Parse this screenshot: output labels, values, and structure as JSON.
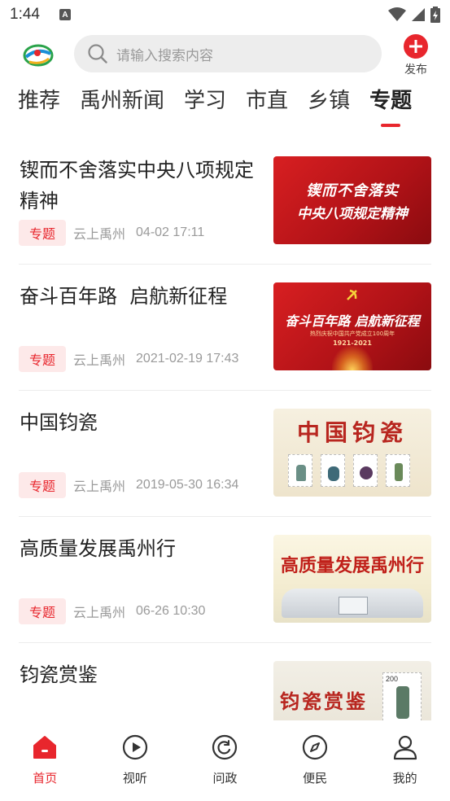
{
  "status_bar": {
    "time": "1:44",
    "notification_icon": "A"
  },
  "header": {
    "logo_icon": "yunshang-yuzhou-logo",
    "search_placeholder": "请输入搜索内容",
    "publish_label": "发布"
  },
  "tabs": [
    {
      "label": "推荐",
      "active": false
    },
    {
      "label": "禹州新闻",
      "active": false
    },
    {
      "label": "学习",
      "active": false
    },
    {
      "label": "市直",
      "active": false
    },
    {
      "label": "乡镇",
      "active": false
    },
    {
      "label": "专题",
      "active": true
    }
  ],
  "articles": [
    {
      "title": "锲而不舍落实中央八项规定精神",
      "tag": "专题",
      "source": "云上禹州",
      "time": "04-02 17:11",
      "thumb_text": [
        "锲而不舍落实",
        "中央八项规定精神"
      ]
    },
    {
      "title": "奋斗百年路  启航新征程",
      "tag": "专题",
      "source": "云上禹州",
      "time": "2021-02-19 17:43",
      "thumb_text": [
        "奋斗百年路 启航新征程",
        "热烈庆祝中国共产党成立100周年",
        "1921-2021"
      ]
    },
    {
      "title": "中国钧瓷",
      "tag": "专题",
      "source": "云上禹州",
      "time": "2019-05-30 16:34",
      "thumb_text": [
        "中国钧瓷"
      ]
    },
    {
      "title": "高质量发展禹州行",
      "tag": "专题",
      "source": "云上禹州",
      "time": "06-26 10:30",
      "thumb_text": [
        "高质量发展禹州行"
      ]
    },
    {
      "title": "钧瓷赏鉴",
      "thumb_text": [
        "钧瓷赏鉴",
        "200"
      ]
    }
  ],
  "bottom_nav": [
    {
      "label": "首页",
      "icon": "home-icon",
      "active": true
    },
    {
      "label": "视听",
      "icon": "play-icon",
      "active": false
    },
    {
      "label": "问政",
      "icon": "refresh-icon",
      "active": false
    },
    {
      "label": "便民",
      "icon": "compass-icon",
      "active": false
    },
    {
      "label": "我的",
      "icon": "user-icon",
      "active": false
    }
  ],
  "colors": {
    "accent": "#e8262d",
    "tag_bg": "#fde9e9",
    "muted_text": "#9a9a9a"
  }
}
